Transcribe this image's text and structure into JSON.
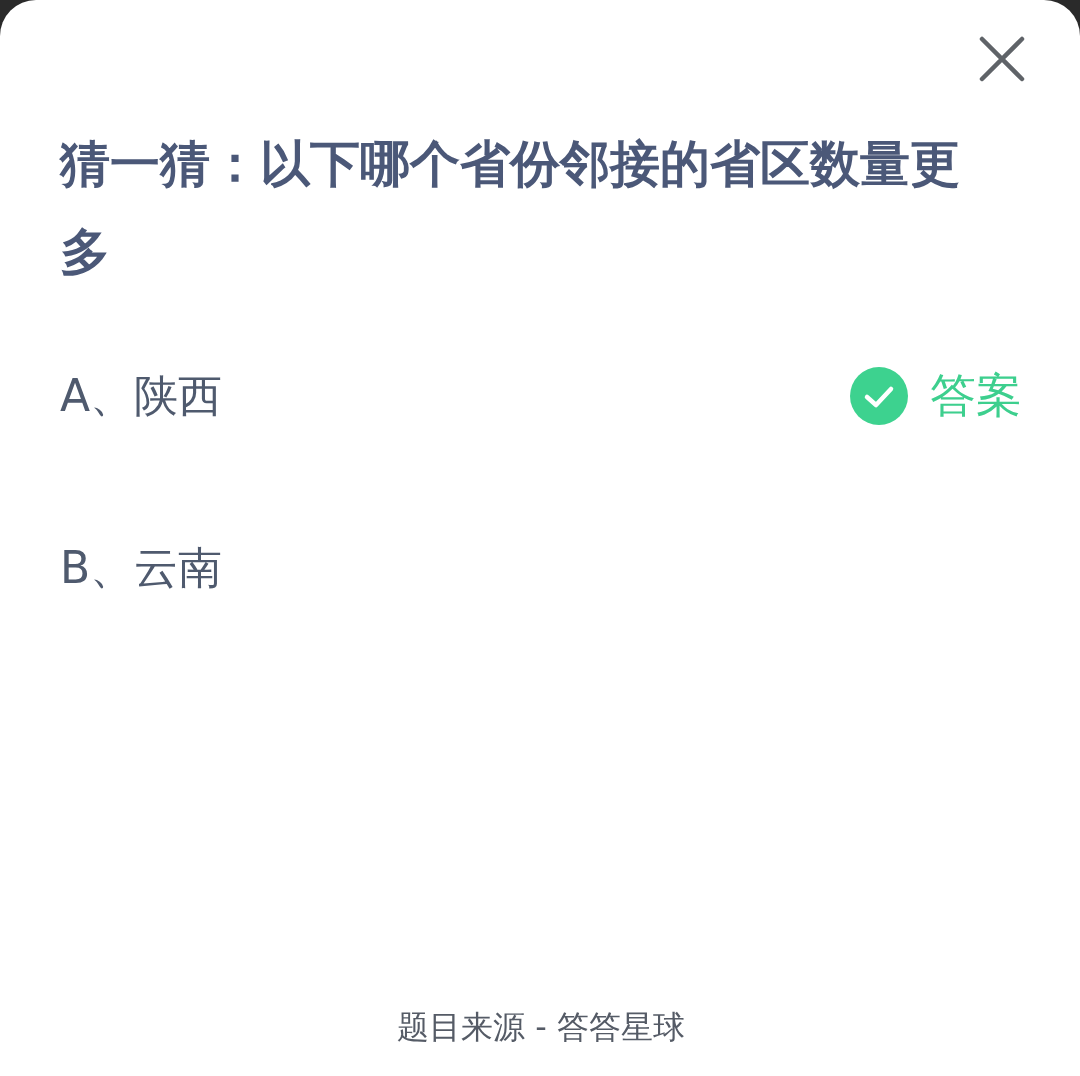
{
  "question": {
    "title": "猜一猜：以下哪个省份邻接的省区数量更多"
  },
  "options": [
    {
      "label": "A、陕西",
      "answer": true
    },
    {
      "label": "B、云南",
      "answer": false
    }
  ],
  "answer_label": "答案",
  "footer": "题目来源 - 答答星球"
}
